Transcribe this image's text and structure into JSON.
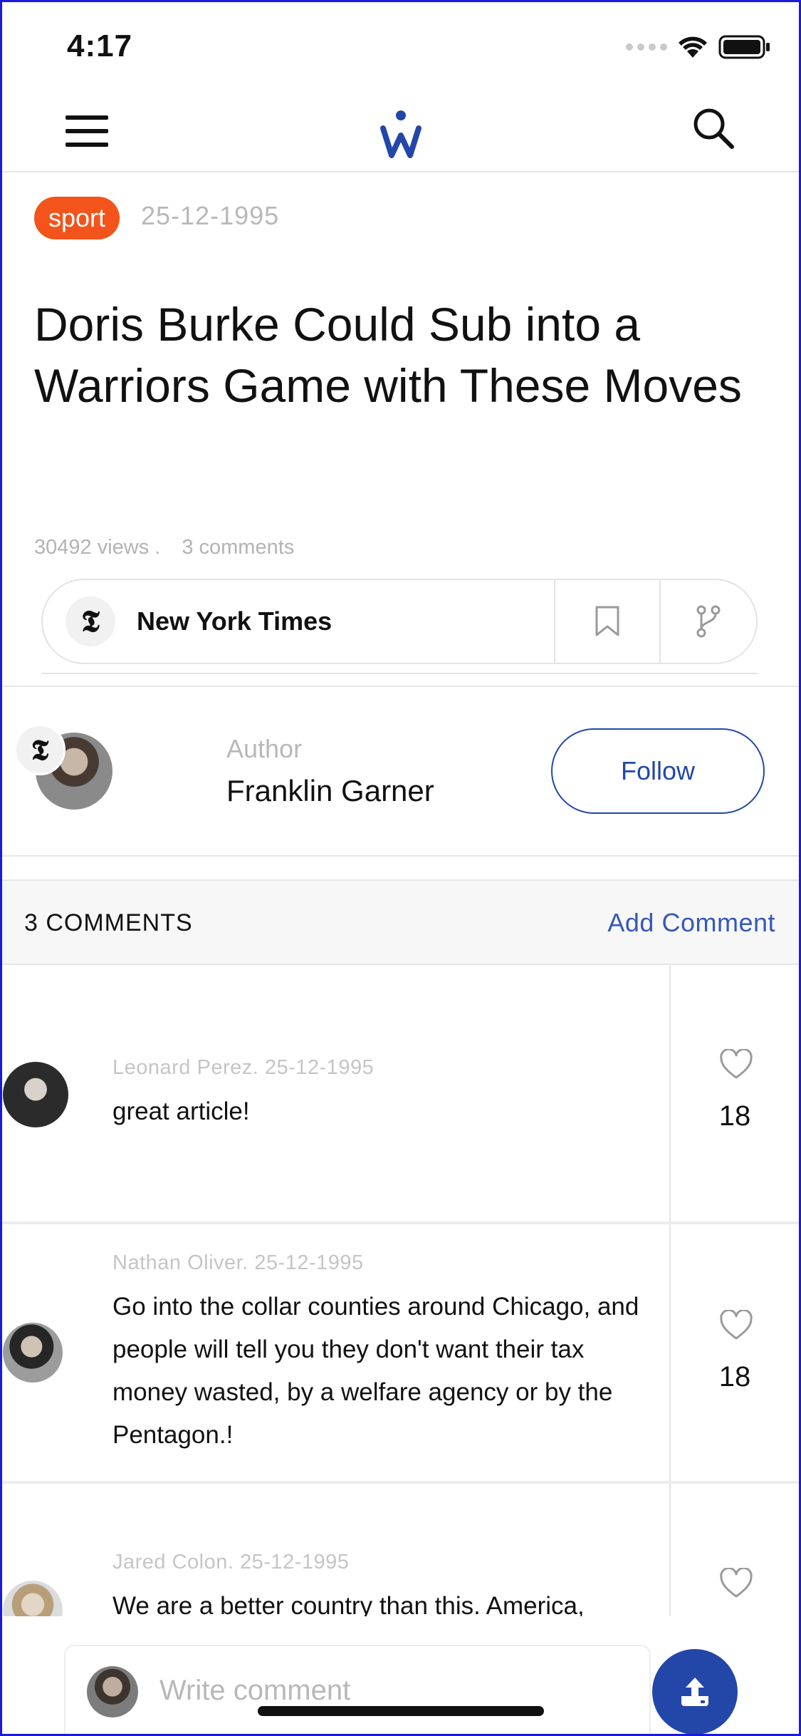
{
  "status_bar": {
    "time": "4:17"
  },
  "nav": {
    "menu_icon": "hamburger-icon",
    "logo_icon": "w-logo-icon",
    "search_icon": "search-icon"
  },
  "article": {
    "tag": "sport",
    "date": "25-12-1995",
    "title": "Doris Burke Could Sub into a Warriors Game with These Moves",
    "views": "30492 views .",
    "comments_count": "3 comments",
    "tag_color": "#f2541b"
  },
  "source": {
    "logo_letter": "𝕿",
    "name": "New York Times",
    "bookmark_icon": "bookmark-icon",
    "share_icon": "branch-icon"
  },
  "author": {
    "label": "Author",
    "name": "Franklin Garner",
    "follow_label": "Follow",
    "badge_letter": "𝕿"
  },
  "comments_header": {
    "title": "3 COMMENTS",
    "add_label": "Add Comment",
    "accent": "#3559b4"
  },
  "comments": [
    {
      "meta": "Leonard Perez. 25-12-1995",
      "text": "great article!",
      "likes": "18"
    },
    {
      "meta": "Nathan Oliver. 25-12-1995",
      "text": "Go into the collar counties around Chicago, and people will tell you they don't want their tax money wasted, by a welfare agency or by the Pentagon.!",
      "likes": "18"
    },
    {
      "meta": "Jared Colon. 25-12-1995",
      "text": "We are a better country than this. America,",
      "likes": ""
    }
  ],
  "composer": {
    "placeholder": "Write comment",
    "upload_icon": "upload-icon",
    "fab_color": "#2347a8"
  }
}
